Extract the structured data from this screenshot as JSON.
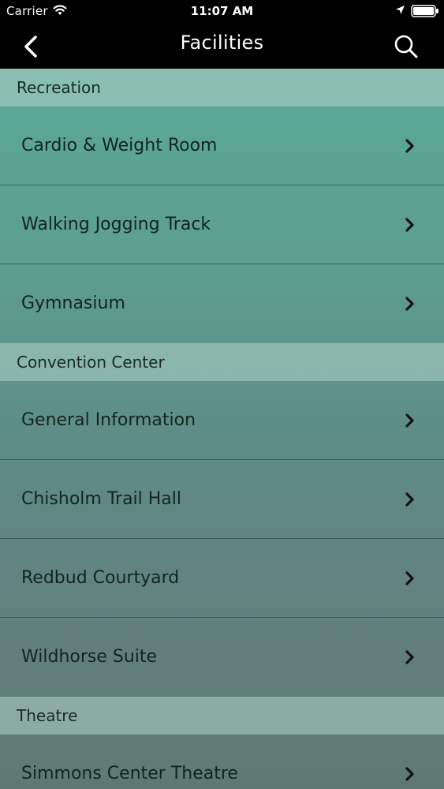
{
  "status_bar": {
    "carrier": "Carrier",
    "time": "11:07 AM"
  },
  "nav_bar": {
    "title": "Facilities",
    "back_icon": "chevron-left-icon",
    "search_icon": "search-icon"
  },
  "sections": [
    {
      "header": "Recreation",
      "items": [
        "Cardio & Weight Room",
        "Walking Jogging Track",
        "Gymnasium"
      ]
    },
    {
      "header": "Convention Center",
      "items": [
        "General Information",
        "Chisholm Trail Hall",
        "Redbud Courtyard",
        "Wildhorse Suite"
      ]
    },
    {
      "header": "Theatre",
      "items": [
        "Simmons Center Theatre"
      ]
    }
  ],
  "colors": {
    "bar_background": "#000000",
    "section_header_tint": "#afd2c8",
    "list_top": "#5ba996",
    "list_bottom": "#5d7a72",
    "text": "#142420"
  }
}
